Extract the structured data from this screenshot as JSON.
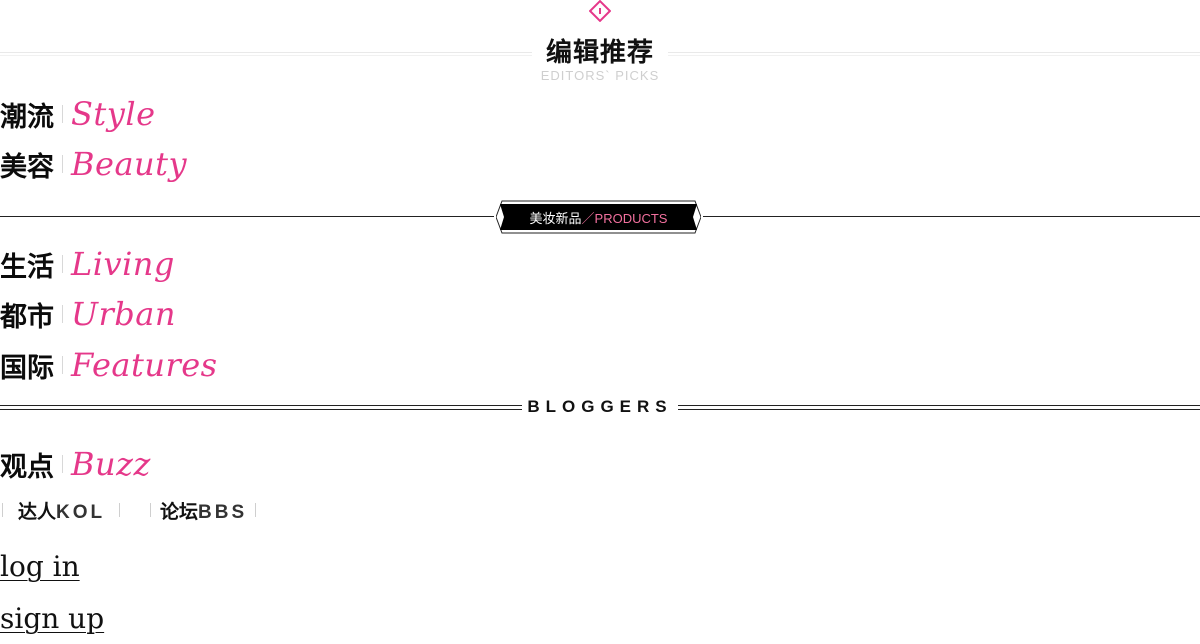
{
  "header": {
    "title": "编辑推荐",
    "subtitle": "EDITORS` PICKS"
  },
  "nav": {
    "style": {
      "zh": "潮流",
      "en": "Style"
    },
    "beauty": {
      "zh": "美容",
      "en": "Beauty"
    },
    "living": {
      "zh": "生活",
      "en": "Living"
    },
    "urban": {
      "zh": "都市",
      "en": "Urban"
    },
    "features": {
      "zh": "国际",
      "en": "Features"
    },
    "buzz": {
      "zh": "观点",
      "en": "Buzz"
    }
  },
  "products": {
    "zh": "美妆新品",
    "slash": "／",
    "en": "PRODUCTS"
  },
  "bloggers": {
    "label": "BLOGGERS"
  },
  "links": {
    "kol": {
      "zh": "达人",
      "en": "KOL"
    },
    "bbs": {
      "zh": "论坛",
      "en": "BBS"
    }
  },
  "auth": {
    "login": "log in",
    "signup": "sign up"
  },
  "colors": {
    "accent": "#e5388a",
    "ribbon": "#000000",
    "text": "#111111"
  }
}
